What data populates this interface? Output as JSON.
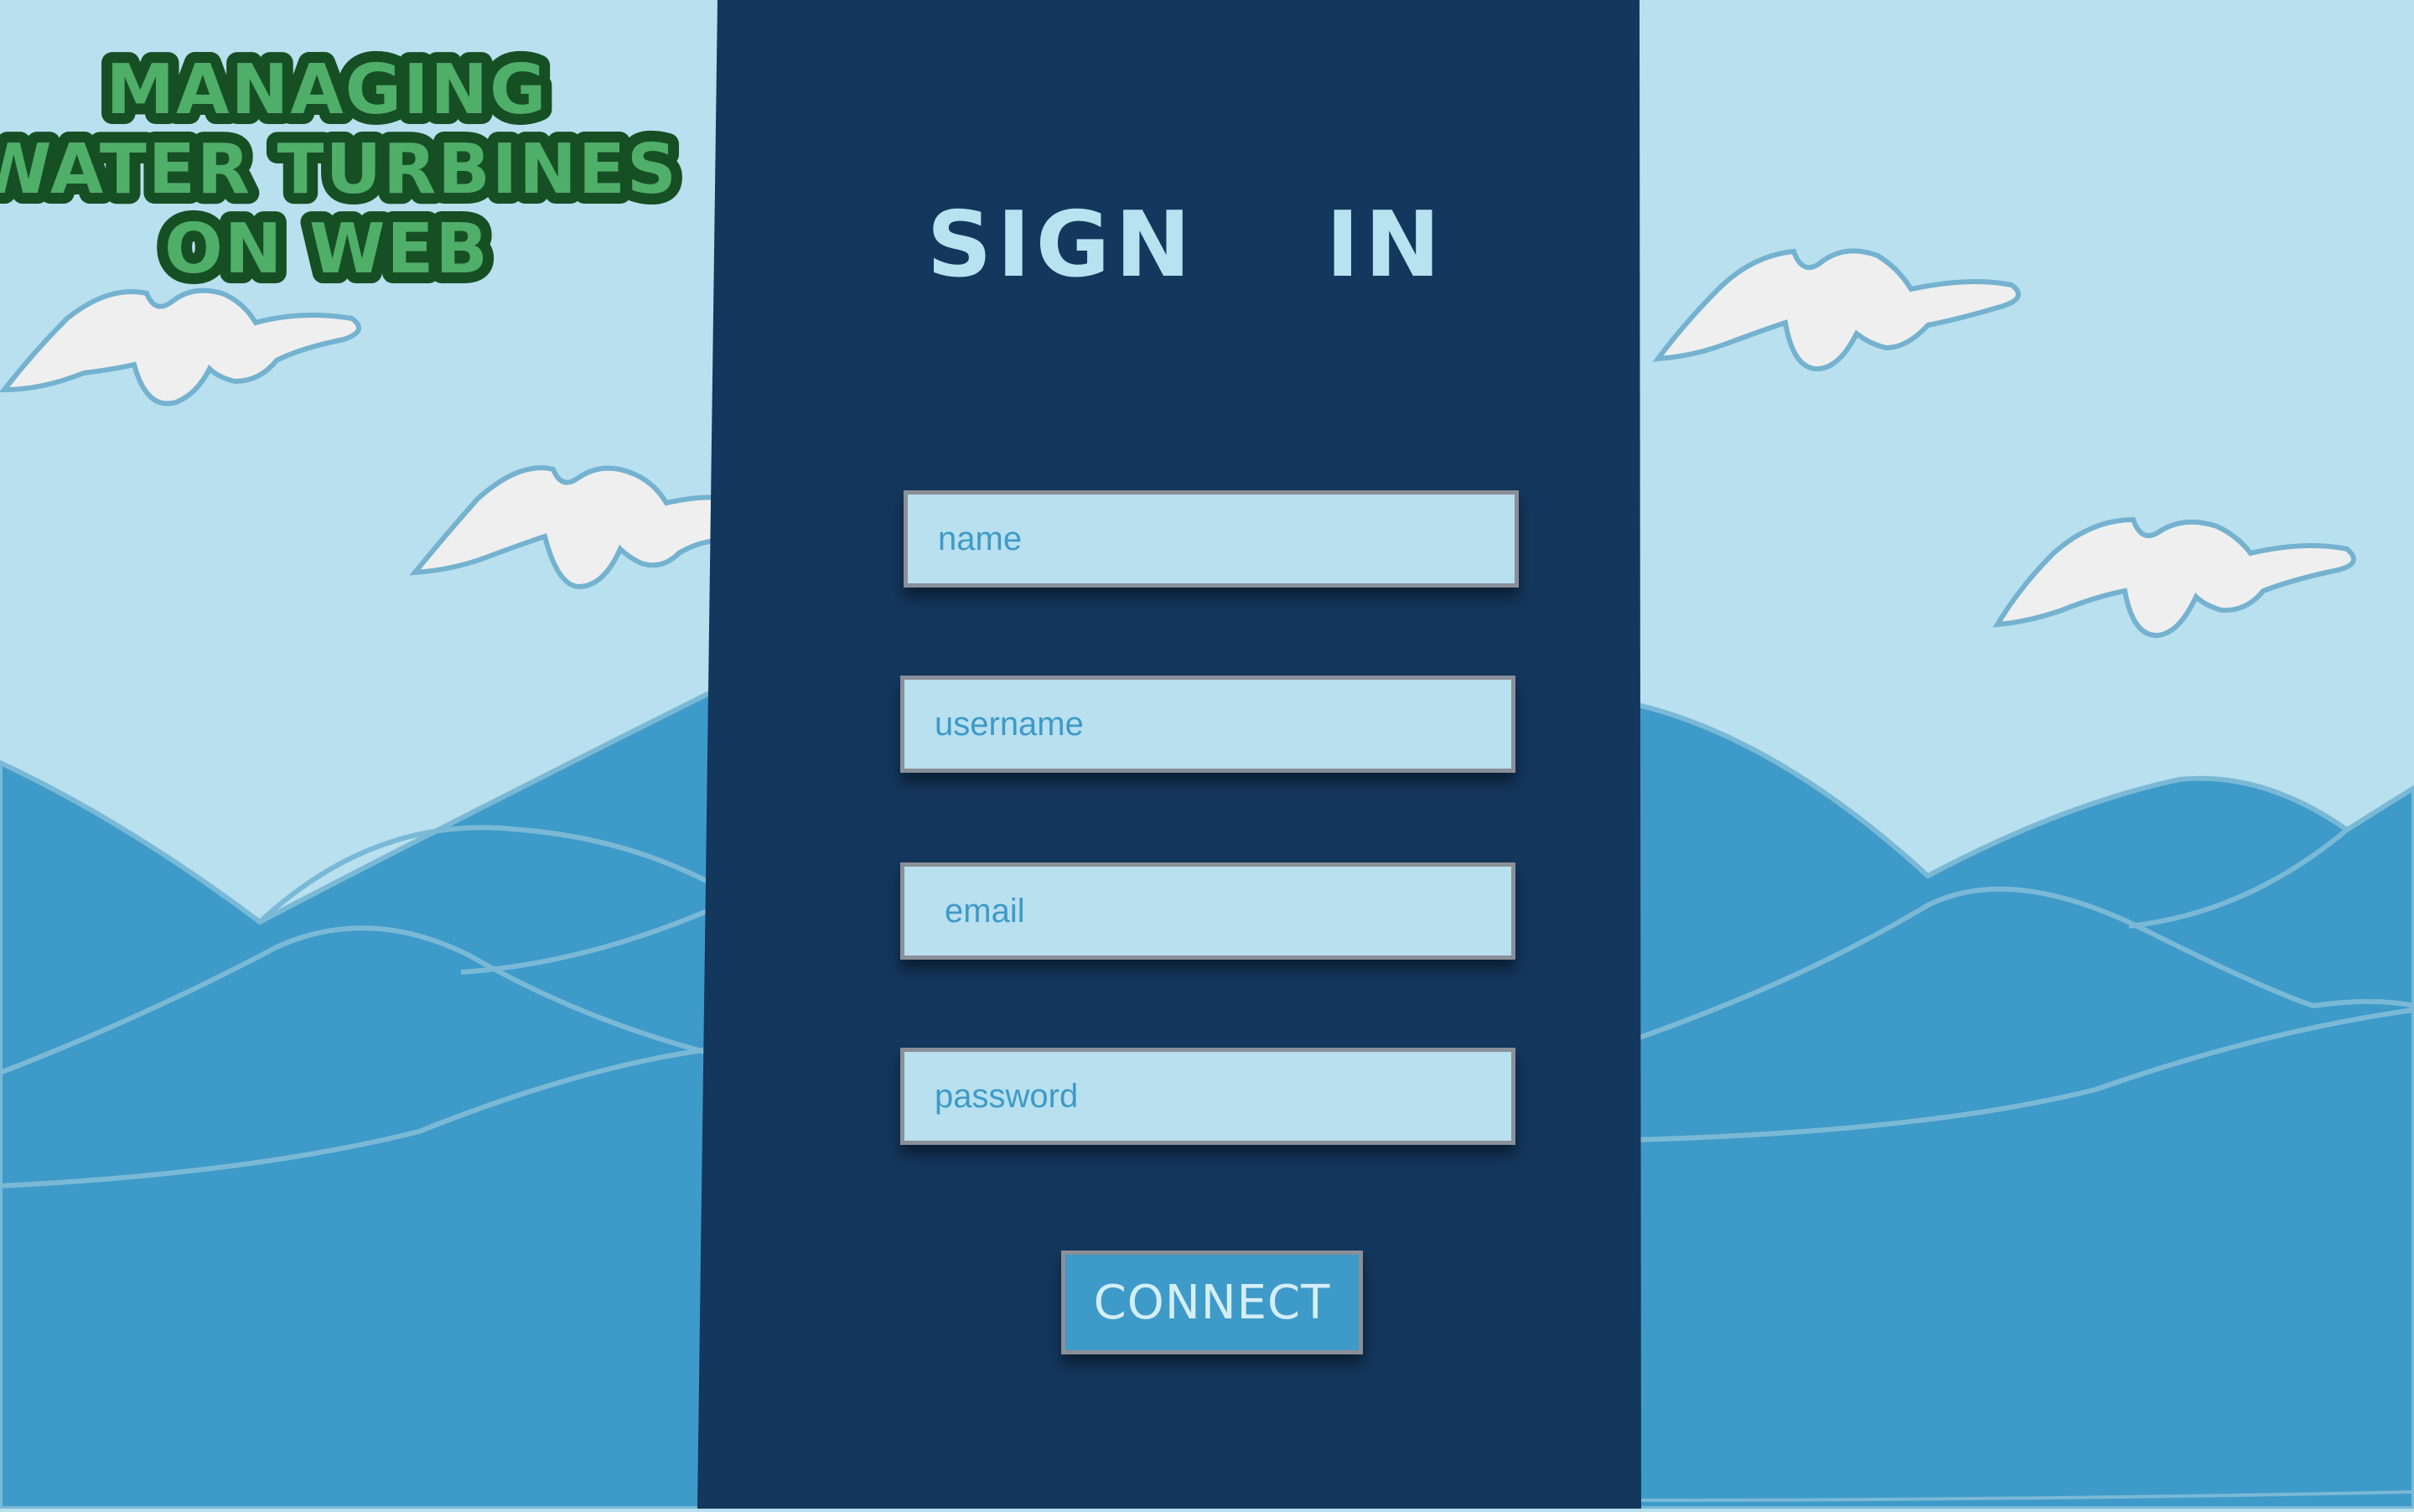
{
  "brand": {
    "line1": "MANAGING",
    "line2": "WATER TURBINES",
    "line3": "ON WEB",
    "fill_color": "#4fae68",
    "outline_color": "#174f24"
  },
  "form": {
    "title": "SIGN  IN",
    "fields": [
      {
        "placeholder": "name"
      },
      {
        "placeholder": "username"
      },
      {
        "placeholder": "email"
      },
      {
        "placeholder": "password"
      }
    ],
    "submit_label": "CONNECT"
  },
  "colors": {
    "sky": "#b8e0ef",
    "hills": "#3e9ac8",
    "hill_lines": "#7ab9d6",
    "panel": "#14375d",
    "cloud_fill": "#efefef",
    "cloud_stroke": "#74b2cf",
    "accent": "#3e9ac8"
  }
}
